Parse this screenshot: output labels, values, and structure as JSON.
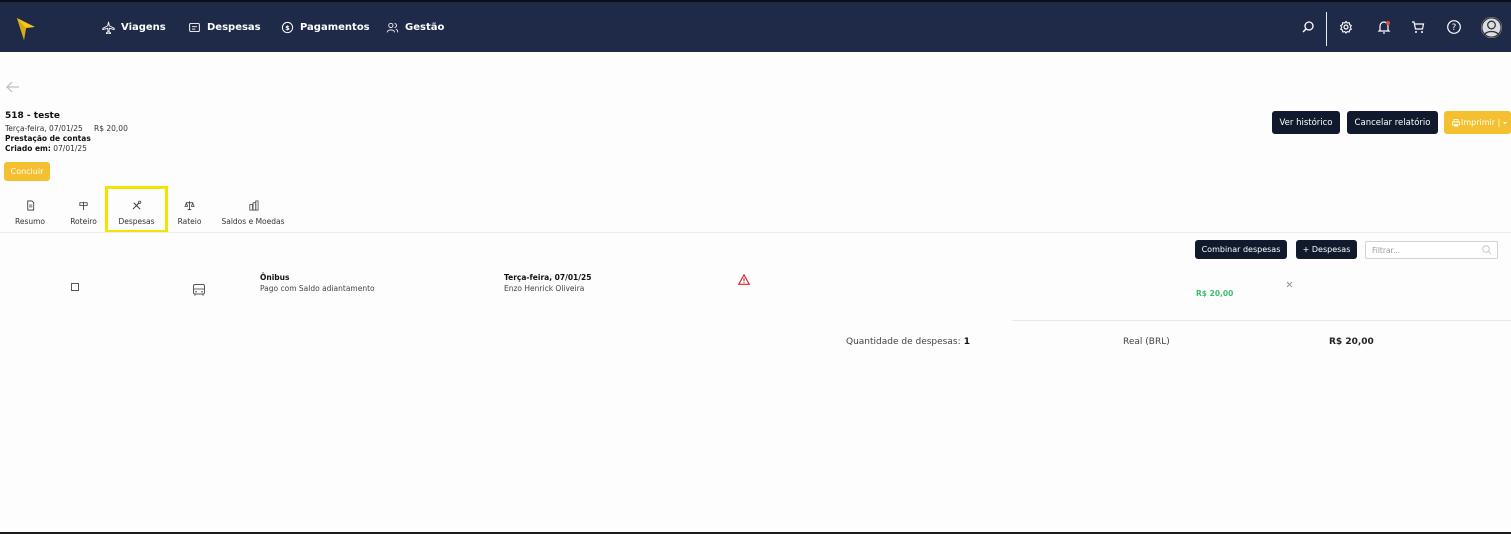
{
  "nav": {
    "items": [
      {
        "label": "Viagens",
        "icon": "plane-icon"
      },
      {
        "label": "Despesas",
        "icon": "receipt-icon"
      },
      {
        "label": "Pagamentos",
        "icon": "dollar-circle-icon"
      },
      {
        "label": "Gestão",
        "icon": "users-icon"
      }
    ],
    "right_icons": [
      "search-icon",
      "gear-icon",
      "bell-icon",
      "cart-icon",
      "help-icon",
      "avatar-icon"
    ]
  },
  "report": {
    "title": "518 - teste",
    "date": "Terça-feira, 07/01/25",
    "amount": "R$ 20,00",
    "type": "Prestação de contas",
    "created_label": "Criado em:",
    "created_value": " 07/01/25"
  },
  "actions": {
    "history": "Ver histórico",
    "cancel": "Cancelar relatório",
    "print": "Imprimir |",
    "conclude": "Concluir"
  },
  "tabs": [
    {
      "label": "Resumo",
      "icon": "document-icon"
    },
    {
      "label": "Roteiro",
      "icon": "signpost-icon"
    },
    {
      "label": "Despesas",
      "icon": "tools-icon"
    },
    {
      "label": "Rateio",
      "icon": "scale-icon"
    },
    {
      "label": "Saldos e Moedas",
      "icon": "coins-icon"
    }
  ],
  "toolbar": {
    "combine": "Combinar despesas",
    "add": "+ Despesas",
    "filter_placeholder": "Filtrar..."
  },
  "expenses": [
    {
      "category": "Ônibus",
      "payment": "Pago com Saldo adiantamento",
      "date": "Terça-feira, 07/01/25",
      "person": "Enzo Henrick Oliveira",
      "amount": "R$ 20,00",
      "icon": "bus-icon",
      "warning_icon": "warning-icon"
    }
  ],
  "summary": {
    "qty_label": "Quantidade de despesas:",
    "qty_value": " 1",
    "currency": "Real (BRL)",
    "total": "R$ 20,00"
  },
  "colors": {
    "topbar": "#1e2a48",
    "dark_button": "#111a2d",
    "accent_yellow": "#f4c02f",
    "highlight": "#f3e400",
    "positive_amount": "#3dbd6f",
    "warning": "#d9262b"
  }
}
